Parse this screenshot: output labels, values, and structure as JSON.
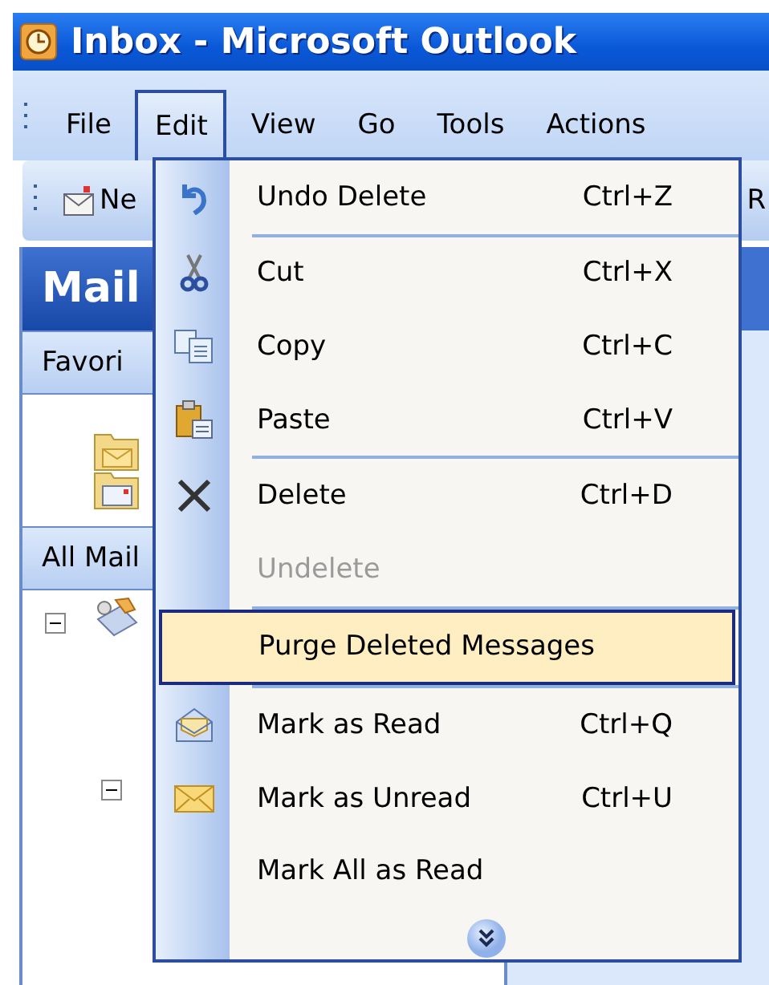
{
  "window": {
    "title": "Inbox - Microsoft Outlook"
  },
  "menu_bar": [
    {
      "label": "File",
      "selected": false
    },
    {
      "label": "Edit",
      "selected": true
    },
    {
      "label": "View",
      "selected": false
    },
    {
      "label": "Go",
      "selected": false
    },
    {
      "label": "Tools",
      "selected": false
    },
    {
      "label": "Actions",
      "selected": false
    }
  ],
  "toolbar": {
    "new_button": "Ne",
    "reply_button": "R"
  },
  "navigation_pane": {
    "title": "Mail",
    "favorites_header": "Favori",
    "all_mail_header": "All Mail"
  },
  "edit_menu": {
    "items": [
      {
        "kind": "item",
        "label": "Undo Delete",
        "shortcut": "Ctrl+Z",
        "disabled": false,
        "selected": false
      },
      {
        "kind": "separator"
      },
      {
        "kind": "item",
        "label": "Cut",
        "shortcut": "Ctrl+X",
        "disabled": false,
        "selected": false
      },
      {
        "kind": "item",
        "label": "Copy",
        "shortcut": "Ctrl+C",
        "disabled": false,
        "selected": false
      },
      {
        "kind": "item",
        "label": "Paste",
        "shortcut": "Ctrl+V",
        "disabled": false,
        "selected": false
      },
      {
        "kind": "separator"
      },
      {
        "kind": "item",
        "label": "Delete",
        "shortcut": "Ctrl+D",
        "disabled": false,
        "selected": false
      },
      {
        "kind": "item",
        "label": "Undelete",
        "disabled": true,
        "selected": false
      },
      {
        "kind": "separator"
      },
      {
        "kind": "item",
        "label": "Purge Deleted Messages",
        "disabled": false,
        "selected": true
      },
      {
        "kind": "separator"
      },
      {
        "kind": "item",
        "label": "Mark as Read",
        "shortcut": "Ctrl+Q",
        "disabled": false,
        "selected": false
      },
      {
        "kind": "item",
        "label": "Mark as Unread",
        "shortcut": "Ctrl+U",
        "disabled": false,
        "selected": false
      },
      {
        "kind": "item",
        "label": "Mark All as Read",
        "disabled": false,
        "selected": false
      }
    ]
  }
}
